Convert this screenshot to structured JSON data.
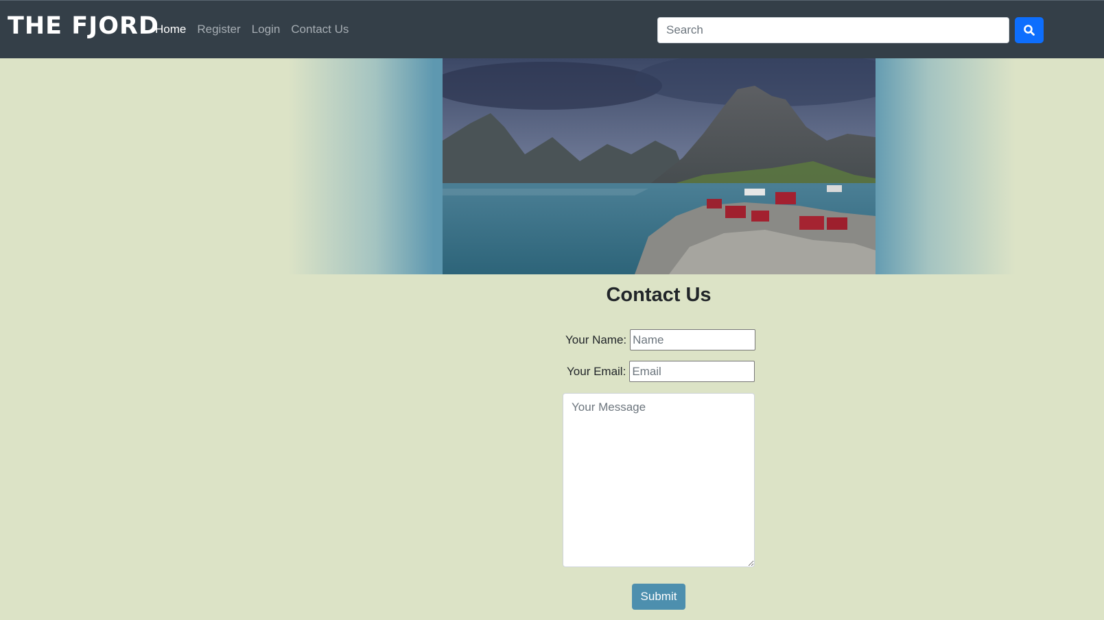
{
  "brand": {
    "name": "THE FJORD"
  },
  "nav": {
    "items": [
      {
        "label": "Home",
        "active": true
      },
      {
        "label": "Register",
        "active": false
      },
      {
        "label": "Login",
        "active": false
      },
      {
        "label": "Contact Us",
        "active": false
      }
    ]
  },
  "search": {
    "placeholder": "Search",
    "value": "",
    "button_icon": "search-icon"
  },
  "hero": {
    "image": "fjord-landscape-photo"
  },
  "contact": {
    "title": "Contact Us",
    "name_label": "Your Name:",
    "name_placeholder": "Name",
    "email_label": "Your Email:",
    "email_placeholder": "Email",
    "message_placeholder": "Your Message",
    "submit_label": "Submit"
  },
  "colors": {
    "navbar": "#343f48",
    "page_background": "#dce3c6",
    "search_button": "#0d6efd",
    "submit_button": "#4d8fae"
  }
}
